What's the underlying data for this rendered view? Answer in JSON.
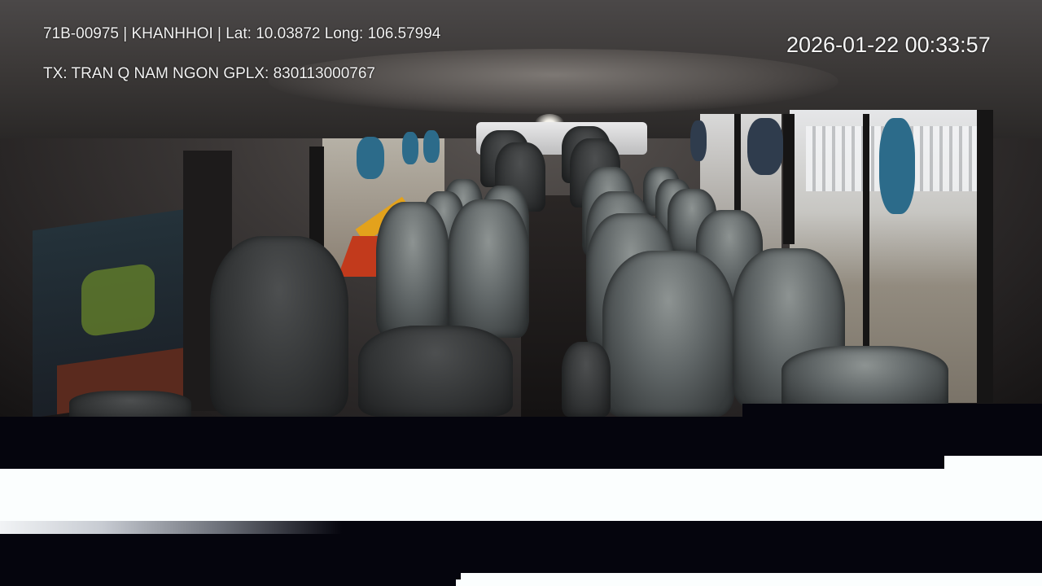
{
  "overlay": {
    "vehicle_line": "71B-00975 | KHANHHOI | Lat: 10.03872 Long: 106.57994",
    "driver_line": "TX: TRAN Q NAM NGON GPLX: 830113000767",
    "timestamp": "2026-01-22 00:33:57"
  },
  "scene": {
    "description_icon": "bus-interior-camera-feed",
    "colors": {
      "seat": "#6a7070",
      "curtain": "#2c6b8a",
      "overlay_text": "#f2f2f2",
      "band_white": "#fbfefe",
      "band_dark": "#05050d"
    }
  }
}
